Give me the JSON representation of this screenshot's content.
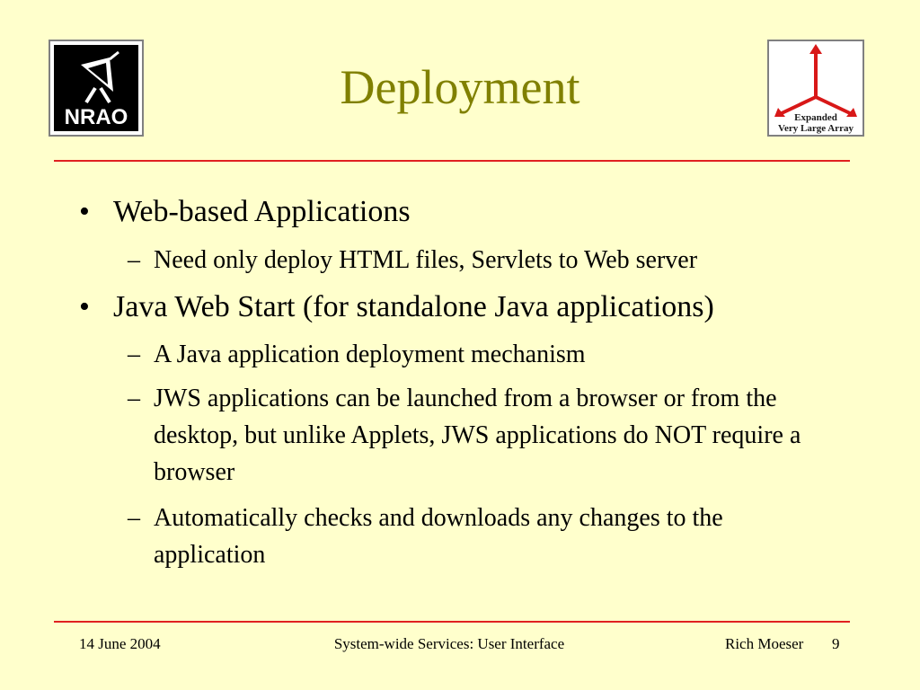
{
  "slide": {
    "title": "Deployment",
    "logo_left_text": "NRAO",
    "logo_right_lines": [
      "Expanded",
      "Very Large Array"
    ]
  },
  "bullets": [
    {
      "text": "Web-based Applications",
      "subs": [
        "Need only deploy HTML files, Servlets to Web server"
      ]
    },
    {
      "text": "Java Web Start (for standalone Java applications)",
      "subs": [
        "A Java application deployment mechanism",
        "JWS applications can be launched from a browser or from the desktop, but unlike Applets, JWS applications do NOT require a browser",
        "Automatically checks and downloads any changes to the application"
      ]
    }
  ],
  "footer": {
    "date": "14 June 2004",
    "center": "System-wide Services: User Interface",
    "author": "Rich Moeser",
    "page": "9"
  },
  "colors": {
    "background": "#ffffcc",
    "title": "#808000",
    "rule": "#e02020"
  }
}
